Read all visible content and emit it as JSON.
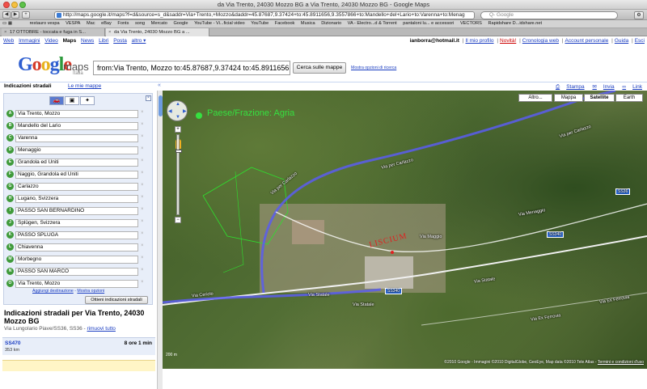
{
  "window": {
    "title": "da Via Trento, 24030 Mozzo BG a Via Trento, 24030 Mozzo BG - Google Maps"
  },
  "toolbar": {
    "url": "http://maps.google.it/maps?f=d&source=s_d&saddr=Via+Trento,+Mozzo&daddr=45.87687,9.37424+to:45.8911656,9.3557866+to:Mandello+del+Lario+to:Varenna+to:Menag",
    "search_placeholder": "Q- Google"
  },
  "bookmarks": [
    "restauro vespa",
    "VESPA",
    "Mac",
    "eBay",
    "Fonts",
    "song",
    "Mercato",
    "Google",
    "YouTube - Vi...ficial video",
    "YouTube",
    "Facebook",
    "Musica",
    "Dizionario",
    "VA - Electro...d & Torrent",
    "pantaloni lu... e accessori",
    "VECTORS",
    "Rapidshare D...idshare.net"
  ],
  "tabs": [
    {
      "label": "17 OTTOBRE - toccata e fuga in S..."
    },
    {
      "label": "da Via Trento, 24030 Mozzo BG a ..."
    }
  ],
  "gbar": {
    "links": [
      "Web",
      "Immagini",
      "Video",
      "Maps",
      "News",
      "Libri",
      "Posta",
      "altro ▾"
    ],
    "current": "Maps",
    "user": "ianborra@hotmail.it",
    "profile": "Il mio profilo",
    "novita": "Novità!",
    "history": "Cronologia web",
    "account": "Account personale",
    "guide": "Guida",
    "exit": "Esci"
  },
  "header": {
    "logo_sub": "maps",
    "logo_country": "Italia",
    "query": "from:Via Trento, Mozzo to:45.87687,9.37424 to:45.8911656,",
    "search_button": "Cerca sulle mappe",
    "options_link": "Mostra opzioni di ricerca"
  },
  "panel": {
    "title": "Indicazioni stradali",
    "my_maps": "Le mie mappe",
    "print": "Stampa",
    "send": "Invia",
    "link": "Link"
  },
  "stops": [
    {
      "letter": "A",
      "value": "Via Trento, Mozzo"
    },
    {
      "letter": "B",
      "value": "Mandello del Lario"
    },
    {
      "letter": "C",
      "value": "Varenna"
    },
    {
      "letter": "D",
      "value": "Menaggio"
    },
    {
      "letter": "E",
      "value": "Grandola ed Uniti"
    },
    {
      "letter": "F",
      "value": "Naggio, Grandola ed Uniti"
    },
    {
      "letter": "G",
      "value": "Carlazzo"
    },
    {
      "letter": "H",
      "value": "Lugano, Svizzera"
    },
    {
      "letter": "I",
      "value": "PASSO SAN BERNARDINO"
    },
    {
      "letter": "J",
      "value": "Splügen, Svizzera"
    },
    {
      "letter": "K",
      "value": "PASSO SPLUGA"
    },
    {
      "letter": "L",
      "value": "Chiavenna"
    },
    {
      "letter": "M",
      "value": "Morbegno"
    },
    {
      "letter": "N",
      "value": "PASSO SAN MARCO"
    },
    {
      "letter": "O",
      "value": "Via Trento, Mozzo"
    }
  ],
  "actions": {
    "add_destination": "Aggiungi destinazione",
    "show_options": "Mostra opzioni",
    "get_directions": "Ottieni indicazioni stradali"
  },
  "result": {
    "title": "Indicazioni stradali per Via Trento, 24030 Mozzo BG",
    "subtitle": "Via Lungolario Piave/SS36, SS36 - ",
    "remove_all": "rimuovi tutto",
    "route_name": "SS470",
    "route_dist": "353 km",
    "route_time": "8 ore 1 min"
  },
  "map": {
    "types": [
      "Altro...",
      "Mappa",
      "Satellite",
      "Earth"
    ],
    "active_type": "Satellite",
    "place_label": "Paese/Frazione: Agria",
    "red_label": "LISCIUM",
    "road_labels": {
      "carlazzo_1": "Via per Carlazzo",
      "carlazzo_2": "Via per Carlazzo",
      "carlazzo_3": "Via per Carlazzo",
      "menaggio": "Via Menaggio",
      "maggio": "Via Maggio",
      "statale_1": "Via Statale",
      "statale_2": "Via Statale",
      "statale_3": "Via Statale",
      "ceriolo": "Via Ceriolo",
      "ferrovia_1": "Via Ex Ferrovia",
      "ferrovia_2": "Via Ex Ferrovia"
    },
    "shields": {
      "a": "SS36",
      "b": "SS340",
      "c": "SS340"
    },
    "scale": "200 m",
    "copyright": "©2010 Google - Immagini ©2010 DigitalGlobe, GeoEye, Map data ©2010 Tele Atlas - ",
    "terms": "Termini e condizioni d'uso"
  }
}
